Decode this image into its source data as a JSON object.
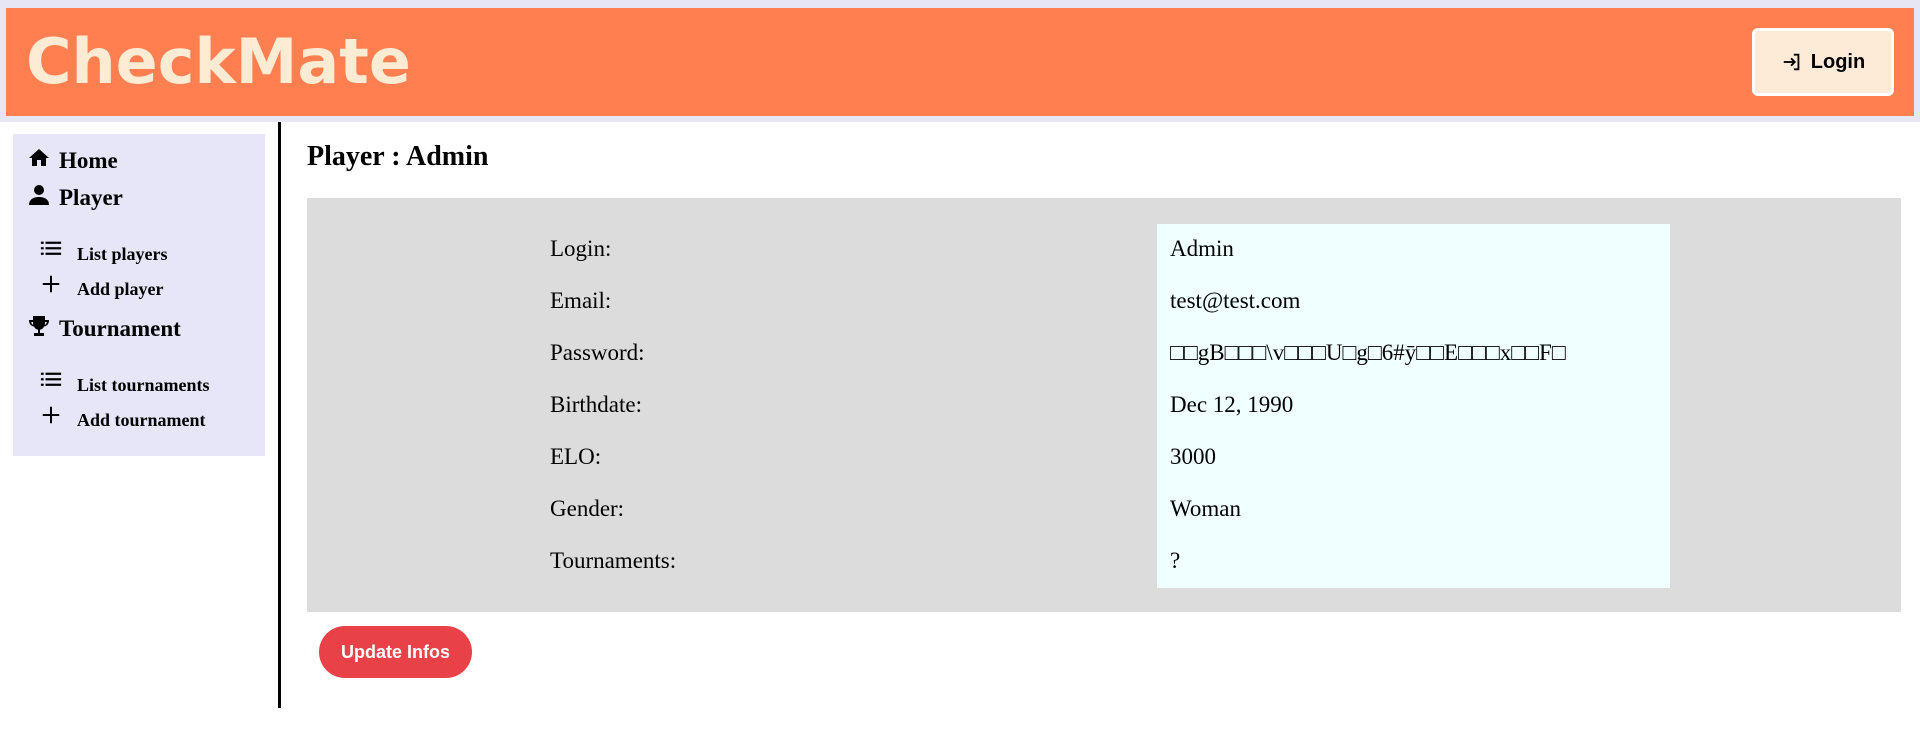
{
  "header": {
    "brand": "CheckMate",
    "login_label": "Login"
  },
  "sidebar": {
    "home": "Home",
    "player": "Player",
    "list_players": "List players",
    "add_player": "Add player",
    "tournament": "Tournament",
    "list_tournaments": "List tournaments",
    "add_tournament": "Add tournament"
  },
  "page": {
    "title": "Player : Admin"
  },
  "player": {
    "fields": [
      {
        "label": "Login:",
        "value": "Admin"
      },
      {
        "label": "Email:",
        "value": "test@test.com"
      },
      {
        "label": "Password:",
        "value": "□□gB□□□\\v□□□U□g□6#ȳ□□E□□□x□□F□"
      },
      {
        "label": "Birthdate:",
        "value": "Dec 12, 1990"
      },
      {
        "label": "ELO:",
        "value": "3000"
      },
      {
        "label": "Gender:",
        "value": "Woman"
      },
      {
        "label": "Tournaments:",
        "value": "?"
      }
    ]
  },
  "actions": {
    "update_label": "Update Infos"
  },
  "colors": {
    "header_bg": "#ff7f50",
    "brand_text": "#fdebd3",
    "sidebar_bg": "#e6e6f8",
    "panel_bg": "#dcdcdc",
    "value_bg": "#f0ffff",
    "update_button": "#e84148"
  },
  "icons": {
    "login": "login-arrow-icon",
    "home": "home-icon",
    "player": "person-icon",
    "list": "list-icon",
    "add": "plus-icon",
    "tournament": "trophy-icon"
  }
}
